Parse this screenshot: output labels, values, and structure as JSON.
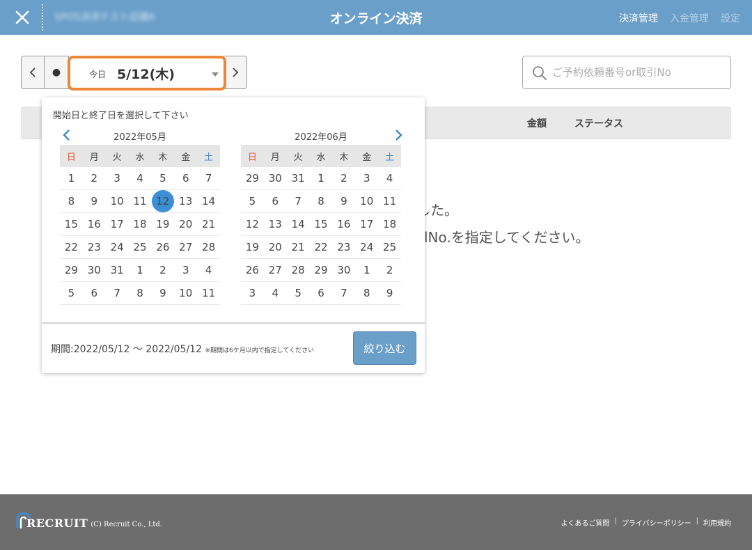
{
  "header": {
    "shop_name": "SPOS決済テスト店舗A",
    "title": "オンライン決済",
    "nav": [
      "決済管理",
      "入金管理",
      "設定"
    ]
  },
  "toolbar": {
    "today_label": "今日",
    "date_value": "5/12(木)",
    "dot": "●"
  },
  "search": {
    "placeholder": "ご予約依頼番号or取引No"
  },
  "table": {
    "columns": [
      "金額",
      "ステータス"
    ]
  },
  "messages": {
    "line1": "した。",
    "line2": "lNo.を指定してください。"
  },
  "calendar": {
    "instruction": "開始日と終了日を選択して下さい",
    "weekdays": [
      "日",
      "月",
      "火",
      "水",
      "木",
      "金",
      "土"
    ],
    "months": [
      {
        "title": "2022年05月",
        "weeks": [
          [
            "1",
            "2",
            "3",
            "4",
            "5",
            "6",
            "7"
          ],
          [
            "8",
            "9",
            "10",
            "11",
            "12",
            "13",
            "14"
          ],
          [
            "15",
            "16",
            "17",
            "18",
            "19",
            "20",
            "21"
          ],
          [
            "22",
            "23",
            "24",
            "25",
            "26",
            "27",
            "28"
          ],
          [
            "29",
            "30",
            "31",
            "1",
            "2",
            "3",
            "4"
          ],
          [
            "5",
            "6",
            "7",
            "8",
            "9",
            "10",
            "11"
          ]
        ]
      },
      {
        "title": "2022年06月",
        "weeks": [
          [
            "29",
            "30",
            "31",
            "1",
            "2",
            "3",
            "4"
          ],
          [
            "5",
            "6",
            "7",
            "8",
            "9",
            "10",
            "11"
          ],
          [
            "12",
            "13",
            "14",
            "15",
            "16",
            "17",
            "18"
          ],
          [
            "19",
            "20",
            "21",
            "22",
            "23",
            "24",
            "25"
          ],
          [
            "26",
            "27",
            "28",
            "29",
            "30",
            "1",
            "2"
          ],
          [
            "3",
            "4",
            "5",
            "6",
            "7",
            "8",
            "9"
          ]
        ]
      }
    ],
    "selected_date": "2022/05/12",
    "period_text": "期間:2022/05/12 〜 2022/05/12",
    "period_note": "※期間は6ケ月以内で指定してください",
    "filter_button": "絞り込む"
  },
  "footer": {
    "logo_text": "RECRUIT",
    "copyright": "(C) Recruit Co., Ltd.",
    "links": [
      "よくあるご質問",
      "プライバシーポリシー",
      "利用規約"
    ],
    "separator": "|"
  },
  "colors": {
    "header": "#6a9fc9",
    "accent_orange": "#ec8638",
    "selected_day": "#3c8fd4",
    "sunday": "#e25a3a",
    "saturday": "#4a8ac4",
    "footer": "#6d6d6d"
  }
}
